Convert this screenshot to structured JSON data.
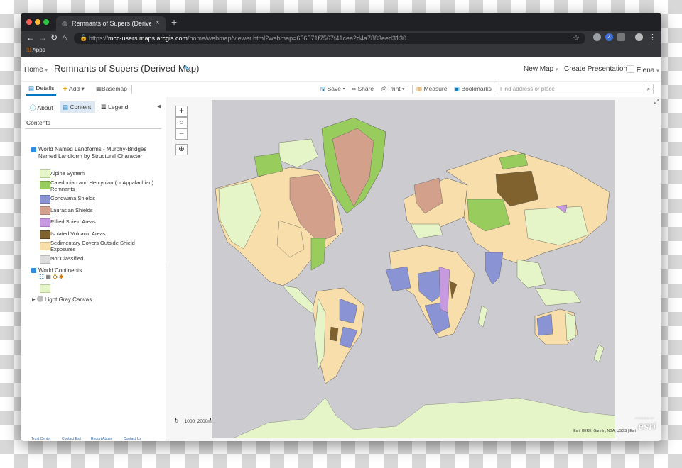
{
  "browser": {
    "tab_title": "Remnants of Supers (Derived M...",
    "new_tab": "+",
    "url_host": "mcc-users.maps.arcgis.com",
    "url_rest": "/home/webmap/viewer.html?webmap=656571f7567f41cea2d4a7883eed3130",
    "url_prefix": "https://",
    "bookmarks_apps": "Apps"
  },
  "app": {
    "home": "Home",
    "title": "Remnants of Supers (Derived Map)",
    "new_map": "New Map",
    "create_presentation": "Create Presentation",
    "user": "Elena"
  },
  "toolbar": {
    "details": "Details",
    "add": "Add",
    "basemap": "Basemap",
    "save": "Save",
    "share": "Share",
    "print": "Print",
    "measure": "Measure",
    "bookmarks": "Bookmarks",
    "search_placeholder": "Find address or place"
  },
  "panel": {
    "tabs": [
      "About",
      "Content",
      "Legend"
    ],
    "contents_label": "Contents",
    "layer1": "World Named Landforms - Murphy-Bridges Named Landform by Structural Character",
    "legend": [
      {
        "label": "Alpine System",
        "color": "#e6f5c8"
      },
      {
        "label": "Caledonian and Hercynian (or Appalachian) Remnants",
        "color": "#98cc5c"
      },
      {
        "label": "Gondwana Shields",
        "color": "#8a93d4"
      },
      {
        "label": "Laurasian Shields",
        "color": "#d3a08c"
      },
      {
        "label": "Rifted Shield Areas",
        "color": "#c79ae0"
      },
      {
        "label": "Isolated Volcanic Areas",
        "color": "#80622f"
      },
      {
        "label": "Sedimentary Covers Outside Shield Exposures",
        "color": "#f7deaa"
      },
      {
        "label": "Not Classified",
        "color": "#dddddd"
      }
    ],
    "layer2": "World Continents",
    "layer3": "Light Gray Canvas",
    "footer": [
      "Trust Center",
      "Contact Esri",
      "Report Abuse",
      "Contact Us"
    ]
  },
  "map": {
    "zoom_in": "+",
    "zoom_out": "−",
    "scale_labels": [
      "0",
      "1000",
      "2000mi"
    ],
    "attribution": "Esri, HERE, Garmin, NGA, USGS | Esri",
    "logo_small": "POWERED BY",
    "logo": "esri"
  }
}
